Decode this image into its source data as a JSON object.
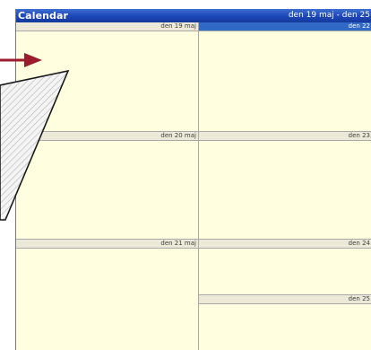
{
  "header": {
    "title": "Calendar",
    "range": "den 19 maj - den 25"
  },
  "days": [
    {
      "label": "den 19 maj",
      "selected": false
    },
    {
      "label": "den 20 maj",
      "selected": false
    },
    {
      "label": "den 21 maj",
      "selected": false
    },
    {
      "label": "den 22",
      "selected": true
    },
    {
      "label": "den 23",
      "selected": false
    },
    {
      "label": "den 24",
      "selected": false
    },
    {
      "label": "den 25",
      "selected": false
    }
  ],
  "colors": {
    "titlebar": "#1c46b8",
    "day_background": "#ffffe0",
    "day_header": "#ece9d8",
    "selected_header": "#3169c6",
    "arrow": "#9b1c2c"
  }
}
